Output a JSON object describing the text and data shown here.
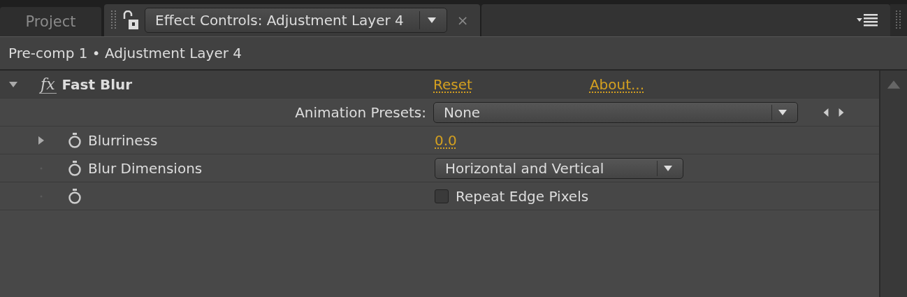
{
  "tabs": [
    {
      "label": "Project",
      "selected": false
    },
    {
      "label": "Effect Controls: Adjustment Layer 4",
      "selected": true
    }
  ],
  "tab_close": "×",
  "breadcrumb": "Pre-comp 1 • Adjustment Layer 4",
  "effect": {
    "badge": "fx",
    "name": "Fast Blur",
    "expanded": true,
    "reset": "Reset",
    "about": "About...",
    "presets_label": "Animation Presets:",
    "presets_value": "None",
    "properties": [
      {
        "kind": "number",
        "name": "Blurriness",
        "expanded": false,
        "value": "0.0"
      },
      {
        "kind": "dropdown",
        "name": "Blur Dimensions",
        "value": "Horizontal and Vertical"
      },
      {
        "kind": "checkbox",
        "label": "Repeat Edge Pixels",
        "checked": false
      }
    ]
  }
}
